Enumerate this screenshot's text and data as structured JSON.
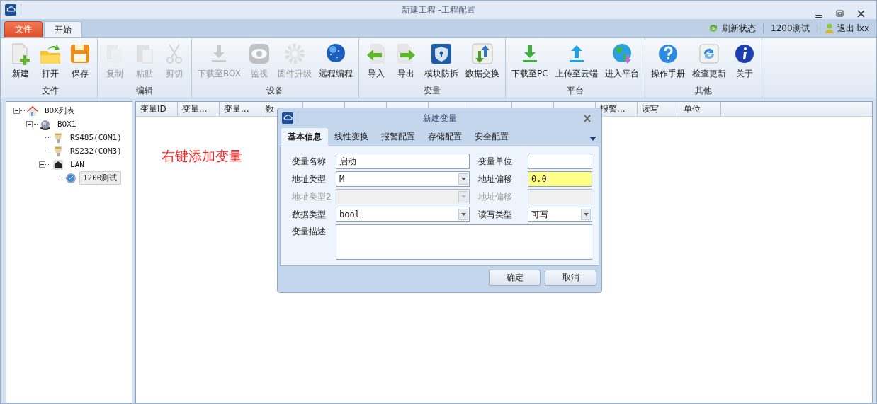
{
  "window": {
    "title": "新建工程 -工程配置"
  },
  "ribbon_tabs": [
    {
      "label": "文件",
      "kind": "menu",
      "selected": false
    },
    {
      "label": "开始",
      "kind": "tab",
      "selected": true
    }
  ],
  "status_links": [
    {
      "label": "刷新状态",
      "kind": "refresh"
    },
    {
      "label": "1200测试",
      "kind": "plain"
    },
    {
      "label": "退出 lxx",
      "kind": "user"
    }
  ],
  "ribbon_groups": [
    {
      "label": "文件",
      "buttons": [
        {
          "label": "新建",
          "disabled": false
        },
        {
          "label": "打开",
          "disabled": false
        },
        {
          "label": "保存",
          "disabled": false
        }
      ]
    },
    {
      "label": "编辑",
      "buttons": [
        {
          "label": "复制",
          "disabled": true
        },
        {
          "label": "粘贴",
          "disabled": true
        },
        {
          "label": "剪切",
          "disabled": true
        }
      ]
    },
    {
      "label": "设备",
      "buttons": [
        {
          "label": "下载至BOX",
          "disabled": true
        },
        {
          "label": "监视",
          "disabled": true
        },
        {
          "label": "固件升级",
          "disabled": true
        },
        {
          "label": "远程编程",
          "disabled": false
        }
      ]
    },
    {
      "label": "变量",
      "buttons": [
        {
          "label": "导入",
          "disabled": false
        },
        {
          "label": "导出",
          "disabled": false
        },
        {
          "label": "模块防拆",
          "disabled": false
        },
        {
          "label": "数据交换",
          "disabled": false
        }
      ]
    },
    {
      "label": "平台",
      "buttons": [
        {
          "label": "下载至PC",
          "disabled": false
        },
        {
          "label": "上传至云端",
          "disabled": false
        },
        {
          "label": "进入平台",
          "disabled": false
        }
      ]
    },
    {
      "label": "其他",
      "buttons": [
        {
          "label": "操作手册",
          "disabled": false
        },
        {
          "label": "检查更新",
          "disabled": false
        },
        {
          "label": "关于",
          "disabled": false
        }
      ]
    }
  ],
  "tree": [
    {
      "label": "BOX列表",
      "expanded": true,
      "selected": false,
      "children": [
        {
          "label": "BOX1",
          "expanded": true,
          "selected": false,
          "children": [
            {
              "label": "RS485(COM1)",
              "selected": false
            },
            {
              "label": "RS232(COM3)",
              "selected": false
            },
            {
              "label": "LAN",
              "expanded": true,
              "selected": false,
              "children": [
                {
                  "label": "1200测试",
                  "selected": true
                }
              ]
            }
          ]
        }
      ]
    }
  ],
  "table": {
    "columns": [
      {
        "kind": "header",
        "label": "变量ID"
      },
      {
        "kind": "header",
        "label": "变量..."
      },
      {
        "kind": "header",
        "label": "变量..."
      },
      {
        "kind": "header",
        "label": "数"
      },
      {
        "kind": "covered"
      },
      {
        "kind": "covered"
      },
      {
        "kind": "covered"
      },
      {
        "kind": "covered"
      },
      {
        "kind": "covered"
      },
      {
        "kind": "covered"
      },
      {
        "kind": "covered"
      },
      {
        "kind": "header",
        "label": "报警..."
      },
      {
        "kind": "header",
        "label": "读写"
      },
      {
        "kind": "header",
        "label": "单位"
      }
    ],
    "hint": "右键添加变量"
  },
  "dialog": {
    "title": "新建变量",
    "tabs": [
      {
        "label": "基本信息",
        "selected": true
      },
      {
        "label": "线性变换",
        "selected": false
      },
      {
        "label": "报警配置",
        "selected": false
      },
      {
        "label": "存储配置",
        "selected": false
      },
      {
        "label": "安全配置",
        "selected": false
      }
    ],
    "fields": [
      {
        "label": "变量名称",
        "kind": "text",
        "value": "启动",
        "disabled": false,
        "highlighted": false
      },
      {
        "label": "变量单位",
        "kind": "text",
        "disabled": false,
        "highlighted": false
      },
      {
        "label": "地址类型",
        "kind": "combo",
        "value": "M",
        "disabled": false,
        "highlighted": false
      },
      {
        "label": "地址偏移",
        "kind": "text",
        "value": "0.0",
        "disabled": false,
        "highlighted": true
      },
      {
        "label": "地址类型2",
        "kind": "combo",
        "disabled": true,
        "highlighted": false
      },
      {
        "label": "地址偏移",
        "kind": "text",
        "disabled": true,
        "highlighted": false
      },
      {
        "label": "数据类型",
        "kind": "combo",
        "value": "bool",
        "disabled": false,
        "highlighted": false
      },
      {
        "label": "读写类型",
        "kind": "combo",
        "value": "可写",
        "disabled": false,
        "highlighted": false
      },
      {
        "label": "变量描述",
        "kind": "area",
        "disabled": false,
        "highlighted": false
      }
    ],
    "buttons": [
      "确定",
      "取消"
    ]
  }
}
